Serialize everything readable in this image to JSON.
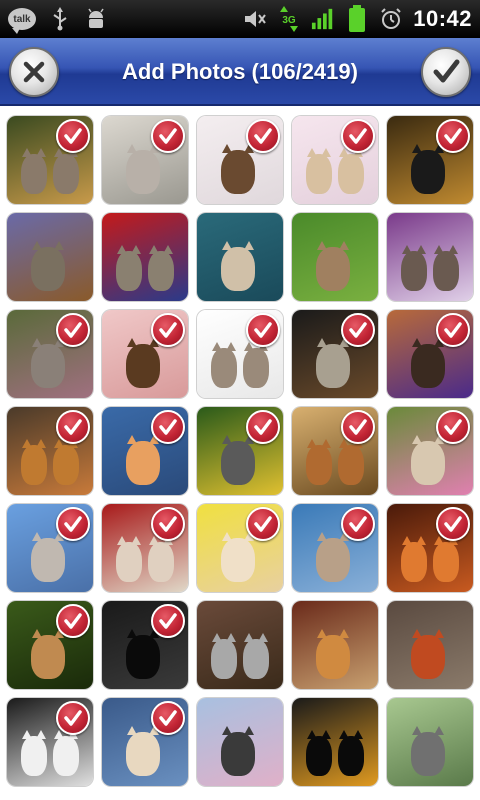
{
  "status_bar": {
    "talk_label": "talk",
    "time": "10:42",
    "network_label": "3G",
    "icons": [
      "talk-icon",
      "usb-icon",
      "android-debug-icon",
      "mute-icon",
      "data-3g-icon",
      "signal-icon",
      "battery-icon",
      "alarm-icon"
    ]
  },
  "header": {
    "title": "Add Photos (106/2419)",
    "cancel_icon": "close-icon",
    "confirm_icon": "check-icon"
  },
  "colors": {
    "title_bar": "#3655b4",
    "check_badge": "#c32535",
    "status_bar": "#000000",
    "signal_green": "#5ad12a"
  },
  "photos": [
    {
      "selected": true,
      "bg1": "#3a4a20",
      "bg2": "#c89a4a",
      "cat": "#8a7a6a"
    },
    {
      "selected": true,
      "bg1": "#dcd8d0",
      "bg2": "#9a9890",
      "cat": "#b8b0a8"
    },
    {
      "selected": true,
      "bg1": "#f4eef0",
      "bg2": "#e0d8dc",
      "cat": "#6a4a30"
    },
    {
      "selected": true,
      "bg1": "#f6e6ee",
      "bg2": "#e4d0dc",
      "cat": "#d8c0a0"
    },
    {
      "selected": true,
      "bg1": "#3a2a10",
      "bg2": "#c08a30",
      "cat": "#1a1a1a"
    },
    {
      "selected": false,
      "bg1": "#6a6aa8",
      "bg2": "#8a5a2a",
      "cat": "#7a7060"
    },
    {
      "selected": false,
      "bg1": "#c41a1a",
      "bg2": "#2a3a8a",
      "cat": "#8a8070"
    },
    {
      "selected": false,
      "bg1": "#2a6a7a",
      "bg2": "#1a4a5a",
      "cat": "#d0c0a8"
    },
    {
      "selected": false,
      "bg1": "#4a8a2a",
      "bg2": "#7ab040",
      "cat": "#a08060"
    },
    {
      "selected": false,
      "bg1": "#7a3a8a",
      "bg2": "#e0d0e8",
      "cat": "#6a5a50"
    },
    {
      "selected": true,
      "bg1": "#5a6a3a",
      "bg2": "#a07080",
      "cat": "#8a8078"
    },
    {
      "selected": true,
      "bg1": "#f0c8c8",
      "bg2": "#d89a9a",
      "cat": "#5a3a20"
    },
    {
      "selected": true,
      "bg1": "#ffffff",
      "bg2": "#e8e8e8",
      "cat": "#9a8a7a"
    },
    {
      "selected": true,
      "bg1": "#1a1a1a",
      "bg2": "#6a4a2a",
      "cat": "#a8a090"
    },
    {
      "selected": true,
      "bg1": "#b86a3a",
      "bg2": "#4a2a8a",
      "cat": "#3a2a20"
    },
    {
      "selected": true,
      "bg1": "#4a3a2a",
      "bg2": "#c87a3a",
      "cat": "#c07a30"
    },
    {
      "selected": true,
      "bg1": "#3a6aa8",
      "bg2": "#2a4a7a",
      "cat": "#e8a060"
    },
    {
      "selected": true,
      "bg1": "#2a5a1a",
      "bg2": "#e0c030",
      "cat": "#5a5a5a"
    },
    {
      "selected": true,
      "bg1": "#d8b070",
      "bg2": "#6a4a20",
      "cat": "#b06a30"
    },
    {
      "selected": true,
      "bg1": "#6a8a3a",
      "bg2": "#e080b0",
      "cat": "#d8c8b0"
    },
    {
      "selected": true,
      "bg1": "#6aa0e0",
      "bg2": "#4a70a8",
      "cat": "#c0b8b0"
    },
    {
      "selected": true,
      "bg1": "#a81a1a",
      "bg2": "#e0d8c8",
      "cat": "#e0d0c0"
    },
    {
      "selected": true,
      "bg1": "#f0e040",
      "bg2": "#e8d0a0",
      "cat": "#f0e0c8"
    },
    {
      "selected": true,
      "bg1": "#3a7ab8",
      "bg2": "#8ab0d8",
      "cat": "#b8a088"
    },
    {
      "selected": true,
      "bg1": "#4a1a0a",
      "bg2": "#c85a20",
      "cat": "#e07a30"
    },
    {
      "selected": true,
      "bg1": "#3a5a1a",
      "bg2": "#1a2a0a",
      "cat": "#c08a50"
    },
    {
      "selected": true,
      "bg1": "#1a1a1a",
      "bg2": "#3a3a3a",
      "cat": "#0a0a0a"
    },
    {
      "selected": false,
      "bg1": "#6a4a3a",
      "bg2": "#3a2a1a",
      "cat": "#a8a8a8"
    },
    {
      "selected": false,
      "bg1": "#6a2a1a",
      "bg2": "#c8a070",
      "cat": "#d08a40"
    },
    {
      "selected": false,
      "bg1": "#5a4a40",
      "bg2": "#8a7a6a",
      "cat": "#c04a20"
    },
    {
      "selected": true,
      "bg1": "#1a1a1a",
      "bg2": "#e0e0e0",
      "cat": "#f0f0f0"
    },
    {
      "selected": true,
      "bg1": "#3a5a8a",
      "bg2": "#6a90c0",
      "cat": "#e8d8c0"
    },
    {
      "selected": false,
      "bg1": "#a8c0e0",
      "bg2": "#e0b0c8",
      "cat": "#3a3a3a"
    },
    {
      "selected": false,
      "bg1": "#1a1a1a",
      "bg2": "#e09a20",
      "cat": "#0a0a0a"
    },
    {
      "selected": false,
      "bg1": "#a8c890",
      "bg2": "#5a7a4a",
      "cat": "#707070"
    }
  ]
}
